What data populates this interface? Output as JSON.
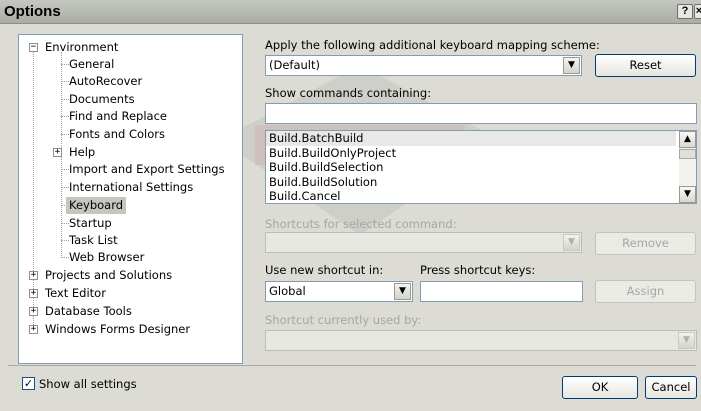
{
  "window": {
    "title": "Options",
    "help_glyph": "?",
    "close_glyph": "×"
  },
  "tree": {
    "root_items": [
      {
        "label": "Environment",
        "expanded": true
      },
      {
        "label": "Projects and Solutions",
        "expanded": false
      },
      {
        "label": "Text Editor",
        "expanded": false
      },
      {
        "label": "Database Tools",
        "expanded": false
      },
      {
        "label": "Windows Forms Designer",
        "expanded": false
      }
    ],
    "environment_children": [
      "General",
      "AutoRecover",
      "Documents",
      "Find and Replace",
      "Fonts and Colors",
      "Help",
      "Import and Export Settings",
      "International Settings",
      "Keyboard",
      "Startup",
      "Task List",
      "Web Browser"
    ],
    "selected": "Keyboard",
    "expand_glyph": "+",
    "collapse_glyph": "−"
  },
  "keyboard": {
    "mapping_label": "Apply the following additional keyboard mapping scheme:",
    "mapping_value": "(Default)",
    "reset_label": "Reset",
    "show_commands_label": "Show commands containing:",
    "show_commands_value": "",
    "commands": [
      "Build.BatchBuild",
      "Build.BuildOnlyProject",
      "Build.BuildSelection",
      "Build.BuildSolution",
      "Build.Cancel"
    ],
    "selected_command": "Build.BatchBuild",
    "shortcuts_label": "Shortcuts for selected command:",
    "remove_label": "Remove",
    "use_new_shortcut_label": "Use new shortcut in:",
    "use_new_shortcut_value": "Global",
    "press_keys_label": "Press shortcut keys:",
    "press_keys_value": "",
    "assign_label": "Assign",
    "currently_used_label": "Shortcut currently used by:"
  },
  "footer": {
    "show_all_label": "Show all settings",
    "show_all_checked": true,
    "check_glyph": "✓",
    "ok_label": "OK",
    "cancel_label": "Cancel"
  },
  "glyphs": {
    "dropdown": "▼",
    "scroll_up": "▲",
    "scroll_down": "▼"
  }
}
